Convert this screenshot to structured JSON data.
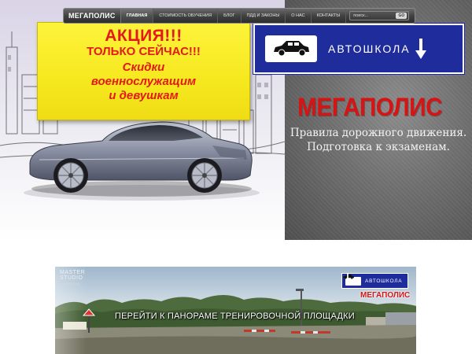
{
  "nav": {
    "logo": "МЕГАПОЛИС",
    "items": [
      {
        "label": "ГЛАВНАЯ",
        "active": true
      },
      {
        "label": "СТОИМОСТЬ ОБУЧЕНИЯ",
        "active": false
      },
      {
        "label": "БЛОГ",
        "active": false
      },
      {
        "label": "ПДД И ЗАКОНЫ",
        "active": false
      },
      {
        "label": "О НАС",
        "active": false
      },
      {
        "label": "КОНТАКТЫ",
        "active": false
      }
    ],
    "search_placeholder": "поиск...",
    "search_button": "GO"
  },
  "promo": {
    "line1": "АКЦИЯ!!!",
    "line2": "ТОЛЬКО СЕЙЧАС!!!",
    "line3": "Скидки",
    "line4": "военнослужащим",
    "line5": "и девушкам"
  },
  "sign": {
    "text": "АВТОШКОЛА",
    "icon": "car-icon",
    "arrow_icon": "arrow-down-icon"
  },
  "hero": {
    "brand": "МЕГАПОЛИС",
    "tagline1": "Правила дорожного движения.",
    "tagline2": "Подготовка к экзаменам."
  },
  "panorama": {
    "logo_line1": "MASTER",
    "logo_line2": "STUDIO",
    "logo_url": "sitevam.com",
    "sign_text": "АВТОШКОЛА",
    "brand": "МЕГАПОЛИС",
    "cta": "ПЕРЕЙТИ К ПАНОРАМЕ ТРЕНИРОВОЧНОЙ ПЛОЩАДКИ"
  },
  "colors": {
    "promo_bg": "#fdf33a",
    "promo_text": "#e21a1a",
    "sign_bg": "#1f2c9c",
    "brand_red": "#d51414",
    "hero_right_bg": "#6f6f6f"
  }
}
